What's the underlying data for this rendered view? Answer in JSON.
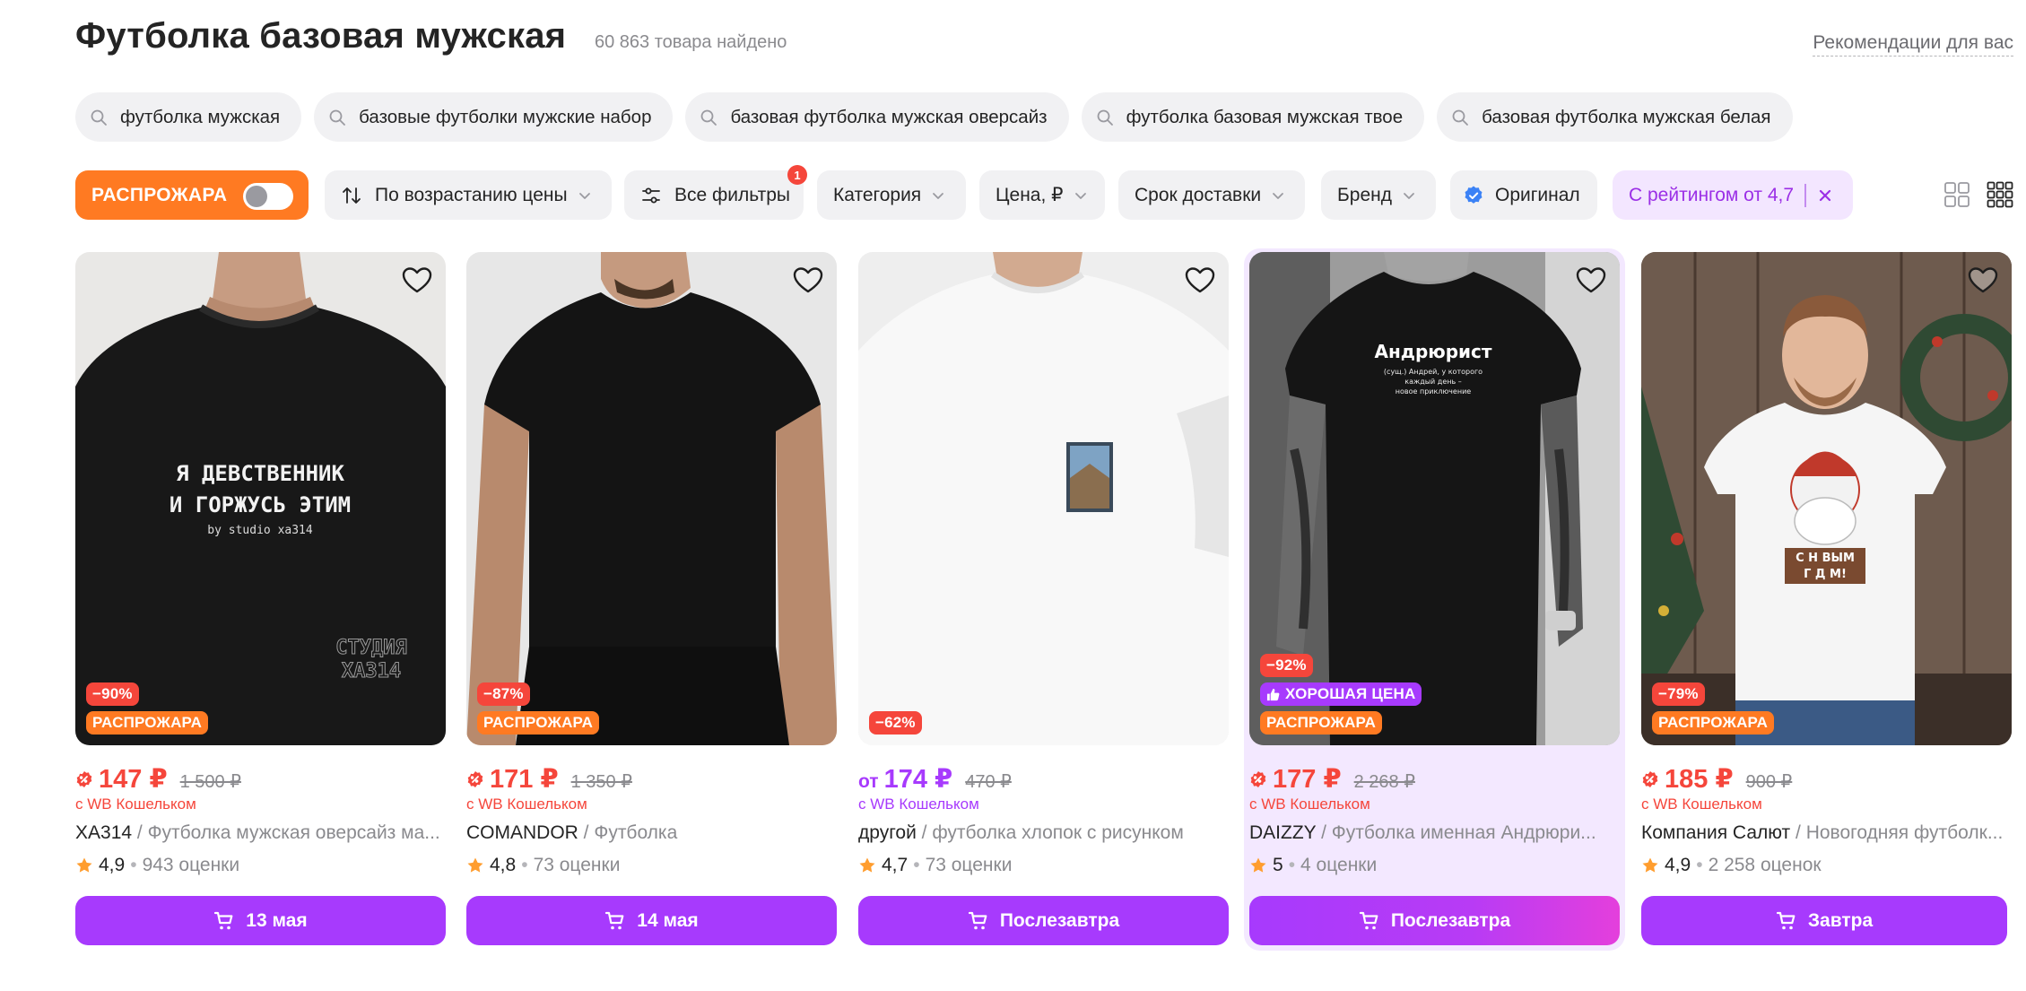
{
  "header": {
    "title": "Футболка базовая мужская",
    "found": "60 863 товара найдено",
    "recommendations": "Рекомендации для вас"
  },
  "suggestions": [
    "футболка мужская",
    "базовые футболки мужские набор",
    "базовая футболка мужская оверсайз",
    "футболка базовая мужская твое",
    "базовая футболка мужская белая"
  ],
  "filters": {
    "sale_label": "РАСПРОЖАРА",
    "sale_enabled": false,
    "sort_label": "По возрастанию цены",
    "all_filters_label": "Все фильтры",
    "all_filters_count": "1",
    "category_label": "Категория",
    "price_label": "Цена, ₽",
    "delivery_label": "Срок доставки",
    "brand_label": "Бренд",
    "original_label": "Оригинал",
    "rating_label": "С рейтингом от 4,7",
    "view_mode": "small-grid"
  },
  "products": [
    {
      "discount": "−90%",
      "badges": [
        "РАСПРОЖАРА"
      ],
      "price_prefix": "",
      "price": "147 ₽",
      "old_price": "1 500 ₽",
      "wallet": "с WB Кошельком",
      "brand": "ХА314",
      "name": " / Футболка мужская оверсайз ма...",
      "rating": "4,9",
      "reviews": "943 оценки",
      "delivery": "13 мая",
      "print_lines": [
        "Я ДЕВСТВЕННИК",
        "И ГОРЖУСЬ ЭТИМ",
        "by studio xa314"
      ],
      "print_corner": [
        "СТУДИЯ",
        "ХА314"
      ]
    },
    {
      "discount": "−87%",
      "badges": [
        "РАСПРОЖАРА"
      ],
      "price_prefix": "",
      "price": "171 ₽",
      "old_price": "1 350 ₽",
      "wallet": "с WB Кошельком",
      "brand": "COMANDOR",
      "name": " / Футболка",
      "rating": "4,8",
      "reviews": "73 оценки",
      "delivery": "14 мая"
    },
    {
      "discount": "−62%",
      "badges": [],
      "price_prefix": "от",
      "price": "174 ₽",
      "old_price": "470 ₽",
      "wallet": "с WB Кошельком",
      "brand": "другой",
      "name": " / футболка хлопок с рисунком",
      "rating": "4,7",
      "reviews": "73 оценки",
      "delivery": "Послезавтра"
    },
    {
      "discount": "−92%",
      "badges": [
        "ХОРОШАЯ ЦЕНА",
        "РАСПРОЖАРА"
      ],
      "price_prefix": "",
      "price": "177 ₽",
      "old_price": "2 268 ₽",
      "wallet": "с WB Кошельком",
      "brand": "DAIZZY",
      "name": " / Футболка именная Андрюри...",
      "rating": "5",
      "reviews": "4 оценки",
      "delivery": "Послезавтра",
      "print_lines": [
        "Андрюрист",
        "(сущ.) Андрей, у которого",
        "каждый день –",
        "новое приключение"
      ]
    },
    {
      "discount": "−79%",
      "badges": [
        "РАСПРОЖАРА"
      ],
      "price_prefix": "",
      "price": "185 ₽",
      "old_price": "900 ₽",
      "wallet": "с WB Кошельком",
      "brand": "Компания Салют",
      "name": " / Новогодняя футболк...",
      "rating": "4,9",
      "reviews": "2 258 оценок",
      "delivery": "Завтра",
      "print_lines": [
        "С Н ВЫМ",
        "Г Д М!"
      ]
    }
  ],
  "colors": {
    "accent": "#a73afd",
    "sale": "#ff7a22",
    "discount": "#f5463b",
    "chip_bg": "#f1f1f3",
    "highlight_bg": "#f3e8ff"
  }
}
